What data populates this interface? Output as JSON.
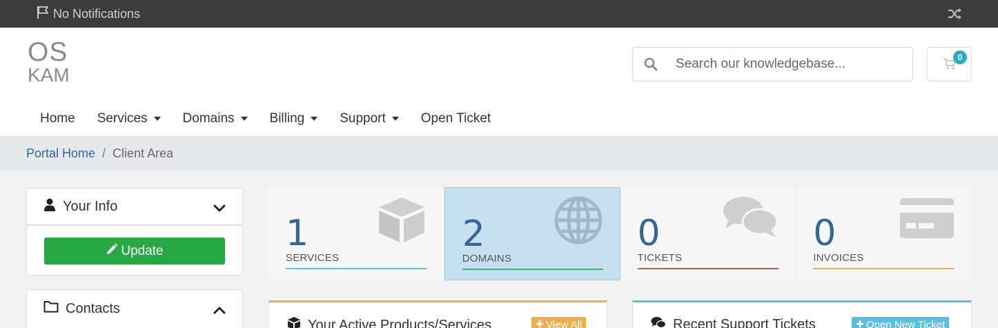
{
  "topbar": {
    "notifications_label": "No Notifications",
    "flag_icon": "flag-icon",
    "shuffle_icon": "shuffle-icon"
  },
  "logo": {
    "line1": "OS",
    "line2": "KAM"
  },
  "search": {
    "placeholder": "Search our knowledgebase..."
  },
  "cart": {
    "count": "0"
  },
  "nav": {
    "items": [
      {
        "label": "Home",
        "dropdown": false
      },
      {
        "label": "Services",
        "dropdown": true
      },
      {
        "label": "Domains",
        "dropdown": true
      },
      {
        "label": "Billing",
        "dropdown": true
      },
      {
        "label": "Support",
        "dropdown": true
      },
      {
        "label": "Open Ticket",
        "dropdown": false
      }
    ]
  },
  "breadcrumb": {
    "home": "Portal Home",
    "separator": "/",
    "current": "Client Area"
  },
  "sidebar": {
    "your_info": {
      "title": "Your Info",
      "button": "Update"
    },
    "contacts": {
      "title": "Contacts"
    }
  },
  "stats": [
    {
      "count": "1",
      "label": "SERVICES",
      "color": "#5bc0de",
      "icon": "cube-icon"
    },
    {
      "count": "2",
      "label": "DOMAINS",
      "color": "#3cb371",
      "icon": "globe-icon"
    },
    {
      "count": "0",
      "label": "TICKETS",
      "color": "#d9534f",
      "icon": "comments-icon"
    },
    {
      "count": "0",
      "label": "INVOICES",
      "color": "#f0ad4e",
      "icon": "credit-card-icon"
    }
  ],
  "cards": {
    "products": {
      "title": "Your Active Products/Services",
      "button": "View All"
    },
    "tickets": {
      "title": "Recent Support Tickets",
      "button": "Open New Ticket"
    }
  },
  "colors": {
    "accent": "#336699",
    "success": "#28a745",
    "warning": "#f0ad4e",
    "info": "#5bc0de",
    "active_tile": "#c5e0ee"
  }
}
